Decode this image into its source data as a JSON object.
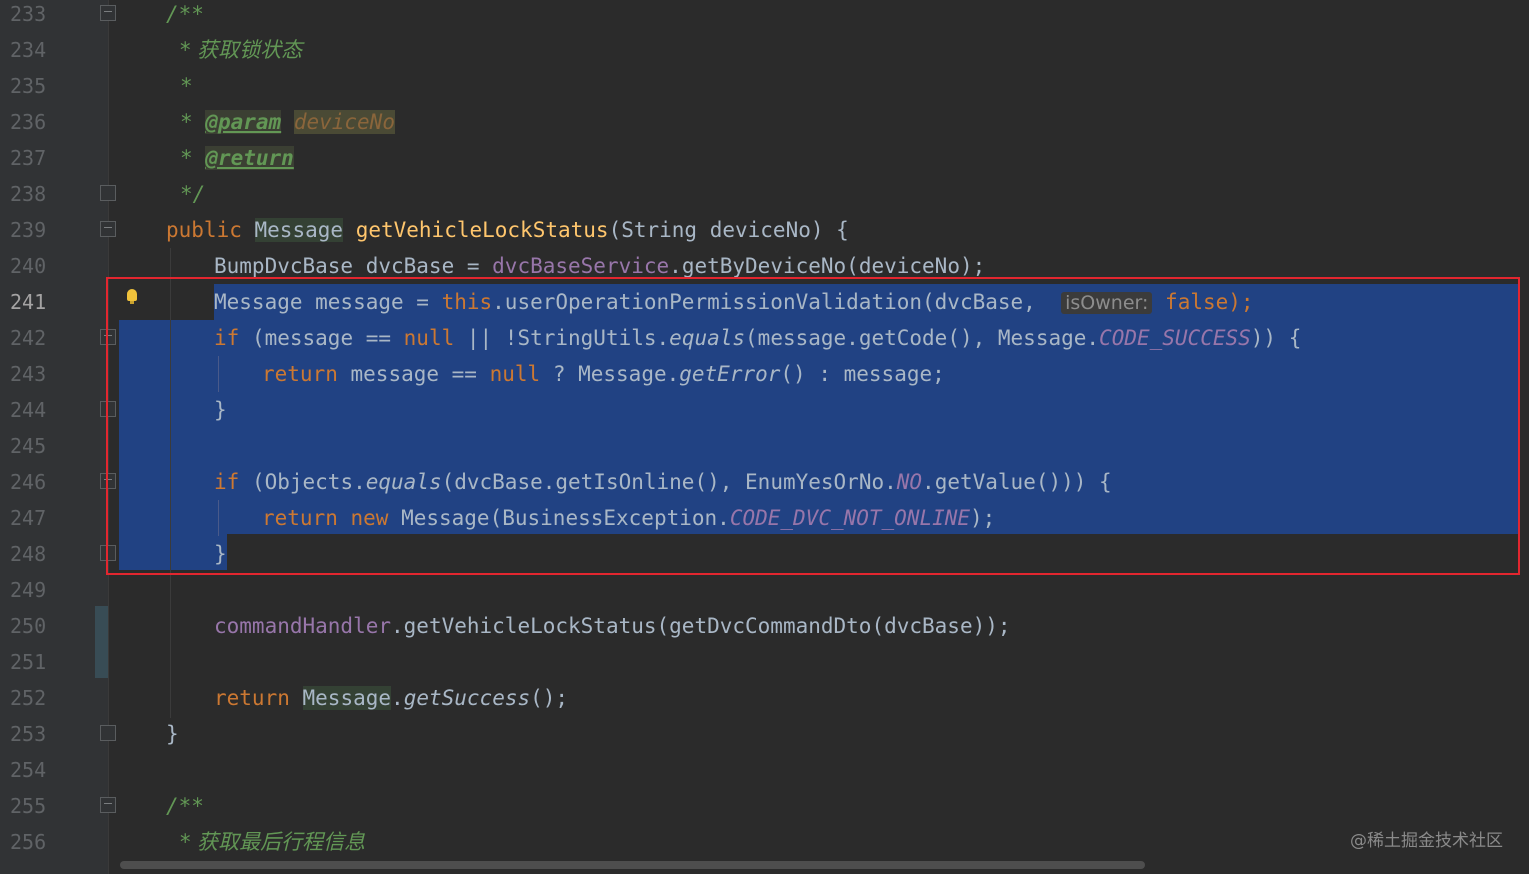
{
  "editor": {
    "line_numbers": [
      "233",
      "234",
      "235",
      "236",
      "237",
      "238",
      "239",
      "240",
      "241",
      "242",
      "243",
      "244",
      "245",
      "246",
      "247",
      "248",
      "249",
      "250",
      "251",
      "252",
      "253",
      "254",
      "255",
      "256"
    ],
    "current_line": "241",
    "lines": {
      "l233": "/**",
      "l234": "* 获取锁状态",
      "l235": "*",
      "l236_star": "* ",
      "l236_tag": "@param",
      "l236_val": "deviceNo",
      "l237_star": "* ",
      "l237_tag": "@return",
      "l238": "*/",
      "l239_kw": "public ",
      "l239_type": "Message",
      "l239_name": "getVehicleLockStatus",
      "l239_rest": "(String deviceNo) {",
      "l240_a": "BumpDvcBase dvcBase = ",
      "l240_field": "dvcBaseService",
      "l240_b": ".getByDeviceNo(deviceNo);",
      "l241_a": "Message message = ",
      "l241_this": "this",
      "l241_b": ".userOperationPermissionValidation(dvcBase,  ",
      "l241_hint": "isOwner:",
      "l241_false": " false",
      "l241_end": ");",
      "l242_if": "if ",
      "l242_a": "(message == ",
      "l242_null": "null",
      "l242_b": " || !StringUtils.",
      "l242_eq": "equals",
      "l242_c": "(message.getCode(), Message.",
      "l242_const": "CODE_SUCCESS",
      "l242_d": ")) {",
      "l243_ret": "return ",
      "l243_a": "message == ",
      "l243_null": "null",
      "l243_b": " ? Message.",
      "l243_err": "getError",
      "l243_c": "() : message;",
      "l244": "}",
      "l246_if": "if ",
      "l246_a": "(Objects.",
      "l246_eq": "equals",
      "l246_b": "(dvcBase.getIsOnline(), EnumYesOrNo.",
      "l246_no": "NO",
      "l246_c": ".getValue())) {",
      "l247_ret": "return new ",
      "l247_a": "Message(BusinessException.",
      "l247_const": "CODE_DVC_NOT_ONLINE",
      "l247_b": ");",
      "l248": "}",
      "l250_field": "commandHandler",
      "l250_a": ".getVehicleLockStatus(getDvcCommandDto(dvcBase));",
      "l252_ret": "return ",
      "l252_type": "Message",
      "l252_a": ".",
      "l252_succ": "getSuccess",
      "l252_b": "();",
      "l253": "}",
      "l255": "/**",
      "l256": "* 获取最后行程信息"
    }
  },
  "watermark": "@稀土掘金技术社区",
  "colors": {
    "background": "#2b2b2b",
    "gutter": "#313335",
    "selection": "#214283",
    "highlight_box": "#e3262f",
    "keyword": "#cc7832",
    "comment": "#629755",
    "constant": "#9876aa",
    "method": "#ffc66d"
  }
}
